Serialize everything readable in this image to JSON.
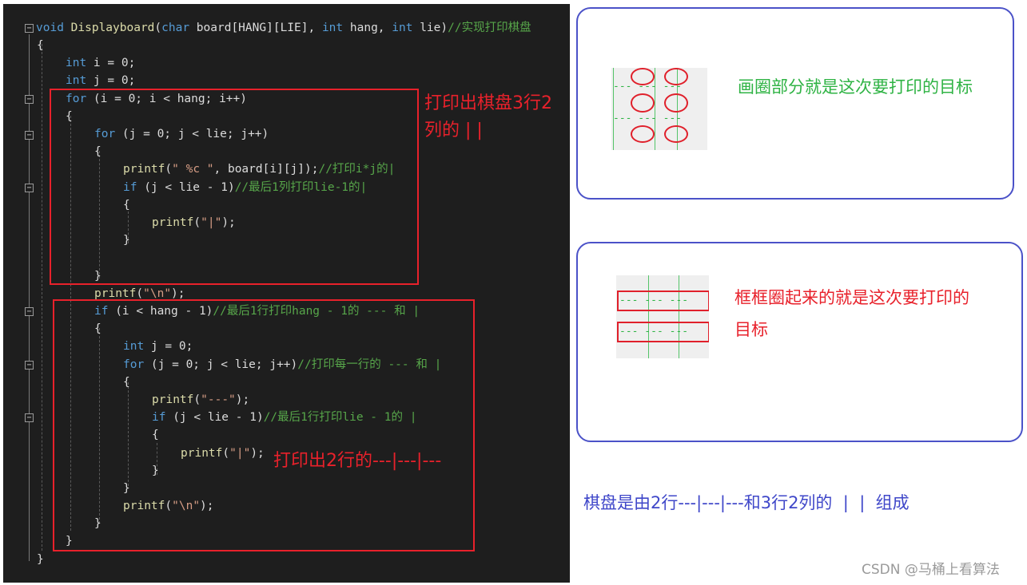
{
  "code": {
    "line1": {
      "a": "void",
      "b": " ",
      "c": "Displayboard",
      "d": "(",
      "e": "char",
      "f": " board[HANG][LIE], ",
      "g": "int",
      "h": " hang, ",
      "i": "int",
      "j": " lie)",
      "k": "//实现打印棋盘"
    },
    "line2": {
      "a": "{"
    },
    "line3": {
      "a": "int",
      "b": " i = 0;"
    },
    "line4": {
      "a": "int",
      "b": " j = 0;"
    },
    "line5": {
      "a": "for",
      "b": " (i = 0; i < hang; i++)"
    },
    "line6": {
      "a": "{"
    },
    "line7": {
      "a": "for",
      "b": " (j = 0; j < lie; j++)"
    },
    "line8": {
      "a": "{"
    },
    "line9": {
      "a": "printf",
      "b": "(",
      "c": "\" %c \"",
      "d": ", board[i][j]);",
      "e": "//打印i*j的|"
    },
    "line10": {
      "a": "if",
      "b": " (j < lie - 1)",
      "c": "//最后1列打印lie-1的|"
    },
    "line11": {
      "a": "{"
    },
    "line12": {
      "a": "printf",
      "b": "(",
      "c": "\"|\"",
      "d": ");"
    },
    "line13": {
      "a": "}"
    },
    "line15": {
      "a": "}"
    },
    "line16": {
      "a": "printf",
      "b": "(",
      "c": "\"\\n\"",
      "d": ");"
    },
    "line17": {
      "a": "if",
      "b": " (i < hang - 1)",
      "c": "//最后1行打印hang - 1的 --- 和 |"
    },
    "line18": {
      "a": "{"
    },
    "line19": {
      "a": "int",
      "b": " j = 0;"
    },
    "line20": {
      "a": "for",
      "b": " (j = 0; j < lie; j++)",
      "c": "//打印每一行的 --- 和 |"
    },
    "line21": {
      "a": "{"
    },
    "line22": {
      "a": "printf",
      "b": "(",
      "c": "\"---\"",
      "d": ");"
    },
    "line23": {
      "a": "if",
      "b": " (j < lie - 1)",
      "c": "//最后1行打印lie - 1的 |"
    },
    "line24": {
      "a": "{"
    },
    "line25": {
      "a": "printf",
      "b": "(",
      "c": "\"|\"",
      "d": ");"
    },
    "line26": {
      "a": "}"
    },
    "line27": {
      "a": "}"
    },
    "line28": {
      "a": "printf",
      "b": "(",
      "c": "\"\\n\"",
      "d": ");"
    },
    "line29": {
      "a": "}"
    },
    "line30": {
      "a": "}"
    },
    "line31": {
      "a": "}"
    },
    "fold_symbol": "−"
  },
  "annotations": {
    "box1_note_line1": "打印出棋盘3行2",
    "box1_note_line2": "列的 |  |",
    "box2_note": "打印出2行的---|---|---"
  },
  "cards": {
    "top_caption": "画圈部分就是这次要打印的目标",
    "middle_caption_line1": "框框圈起来的就是这次要打印的",
    "middle_caption_line2": "目标",
    "mini_dash_row": "--- --- ---",
    "mini_dash_short": "---  ---"
  },
  "summary": "棋盘是由2行---|---|---和3行2列的  |  |  组成",
  "watermark": "CSDN @马桶上看算法",
  "colors": {
    "code_bg": "#1e1e1e",
    "keyword": "#569cd6",
    "function": "#dcdcaa",
    "comment": "#57a64a",
    "string": "#d69d85",
    "annotation_red": "#e8212b",
    "card_border": "#4b52c8",
    "caption_green": "#2fb344",
    "summary_blue": "#3f47c9"
  }
}
